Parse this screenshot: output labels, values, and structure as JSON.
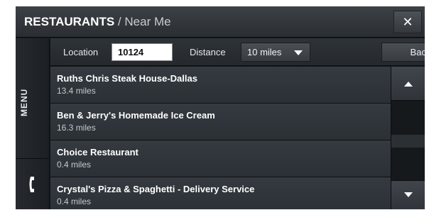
{
  "header": {
    "title": "RESTAURANTS",
    "separator": "/",
    "subtitle": "Near Me",
    "close_glyph": "✕"
  },
  "sidebar": {
    "menu_label": "MENU",
    "phone_icon": "phone-icon"
  },
  "filters": {
    "location_label": "Location",
    "location_value": "10124",
    "distance_label": "Distance",
    "distance_value": "10 miles",
    "back_label": "Back"
  },
  "restaurants": [
    {
      "name": "Ruths Chris Steak House-Dallas",
      "distance": "13.4 miles"
    },
    {
      "name": "Ben & Jerry's Homemade Ice Cream",
      "distance": "16.3 miles"
    },
    {
      "name": "Choice Restaurant",
      "distance": "0.4 miles"
    },
    {
      "name": "Crystal's Pizza & Spaghetti - Delivery Service",
      "distance": "0.4 miles"
    }
  ],
  "scrollbar": {
    "up_icon": "chevron-up-icon",
    "down_icon": "chevron-down-icon"
  },
  "colors": {
    "background": "#15191d",
    "row": "#343a40",
    "text": "#ffffff"
  }
}
